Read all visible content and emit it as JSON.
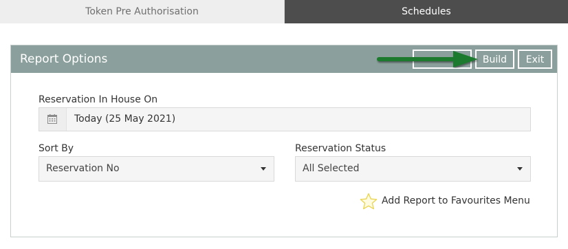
{
  "tabs": [
    {
      "label": "Token Pre Authorisation"
    },
    {
      "label": "Schedules"
    }
  ],
  "panel": {
    "title": "Report Options",
    "buttons": {
      "hidden_label": "",
      "build_label": "Build",
      "exit_label": "Exit"
    }
  },
  "form": {
    "in_house": {
      "label": "Reservation In House On",
      "value": "Today (25 May 2021)",
      "icon": "calendar-icon"
    },
    "sort_by": {
      "label": "Sort By",
      "value": "Reservation No"
    },
    "reservation_status": {
      "label": "Reservation Status",
      "value": "All Selected"
    },
    "favourites": {
      "label": "Add Report to Favourites Menu",
      "icon": "star-icon"
    }
  },
  "colors": {
    "header_bg": "#8ba09c",
    "active_tab_bg": "#4d4d4d",
    "arrow": "#1f7a2e",
    "star": "#e8d44d"
  }
}
